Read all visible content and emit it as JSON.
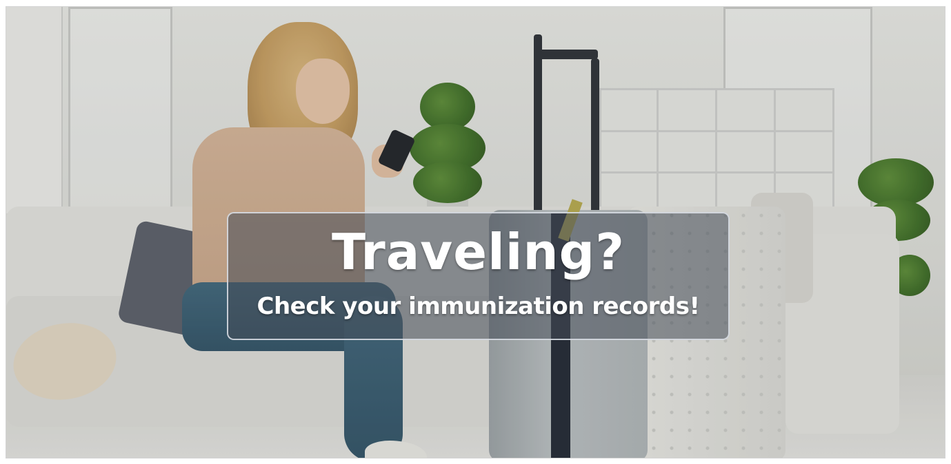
{
  "banner": {
    "title": "Traveling?",
    "subtitle": "Check your immunization records!"
  },
  "photo": {
    "description_icon": "woman-with-suitcase-photo"
  },
  "colors": {
    "banner_background": "#464c58",
    "banner_border": "#e1e4eb",
    "text": "#ffffff"
  }
}
